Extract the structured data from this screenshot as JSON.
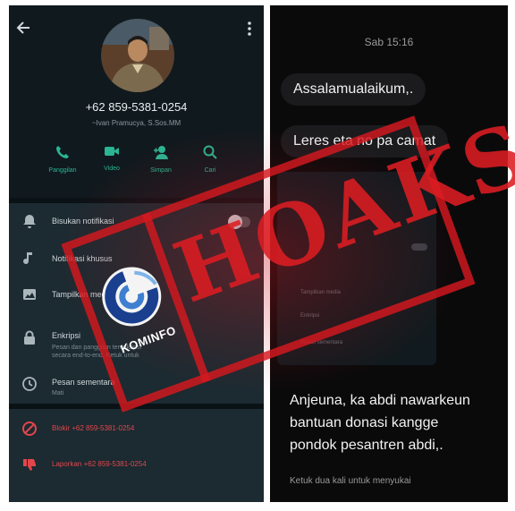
{
  "left": {
    "contact_number": "+62 859-5381-0254",
    "contact_name": "~Ivan Pramucya, S.Sos.MM",
    "actions": [
      {
        "icon": "phone-icon",
        "label": "Panggilan"
      },
      {
        "icon": "video-icon",
        "label": "Video"
      },
      {
        "icon": "add-person-icon",
        "label": "Simpan"
      },
      {
        "icon": "search-icon",
        "label": "Cari"
      }
    ],
    "settings": [
      {
        "icon": "bell-icon",
        "title": "Bisukan notifikasi",
        "sub": ""
      },
      {
        "icon": "music-note-icon",
        "title": "Notifikasi khusus",
        "sub": ""
      },
      {
        "icon": "image-icon",
        "title": "Tampilkan media",
        "sub": ""
      },
      {
        "icon": "lock-icon",
        "title": "Enkripsi",
        "sub": "Pesan dan panggilan terenkripsi secara end-to-end. Ketuk untuk memverifikasi."
      },
      {
        "icon": "timer-icon",
        "title": "Pesan sementara",
        "sub": "Mati"
      }
    ],
    "block_text": "Blokir +62 859-5381-0254",
    "report_text": "Laporkan +62 859-5381-0254"
  },
  "right": {
    "timestamp": "Sab 15:16",
    "bubbles": [
      "Assalamualaikum,.",
      "Leres eta no pa camat"
    ],
    "message_lines": [
      "Anjeuna, ka abdi nawarkeun",
      "bantuan donasi kangge",
      "pondok pesantren abdi,."
    ],
    "hint": "Ketuk dua kali untuk menyukai",
    "inner_items": [
      "Tampilkan media",
      "Enkripsi",
      "Pesan sementara"
    ]
  },
  "stamp": {
    "word": "HOAKS",
    "logo_text": "KOMINFO"
  },
  "colors": {
    "accent_green": "#2bb592",
    "stamp_red": "#d6181e",
    "whatsapp_bg": "#1c2a31",
    "chat_bg": "#0a0a0b"
  }
}
